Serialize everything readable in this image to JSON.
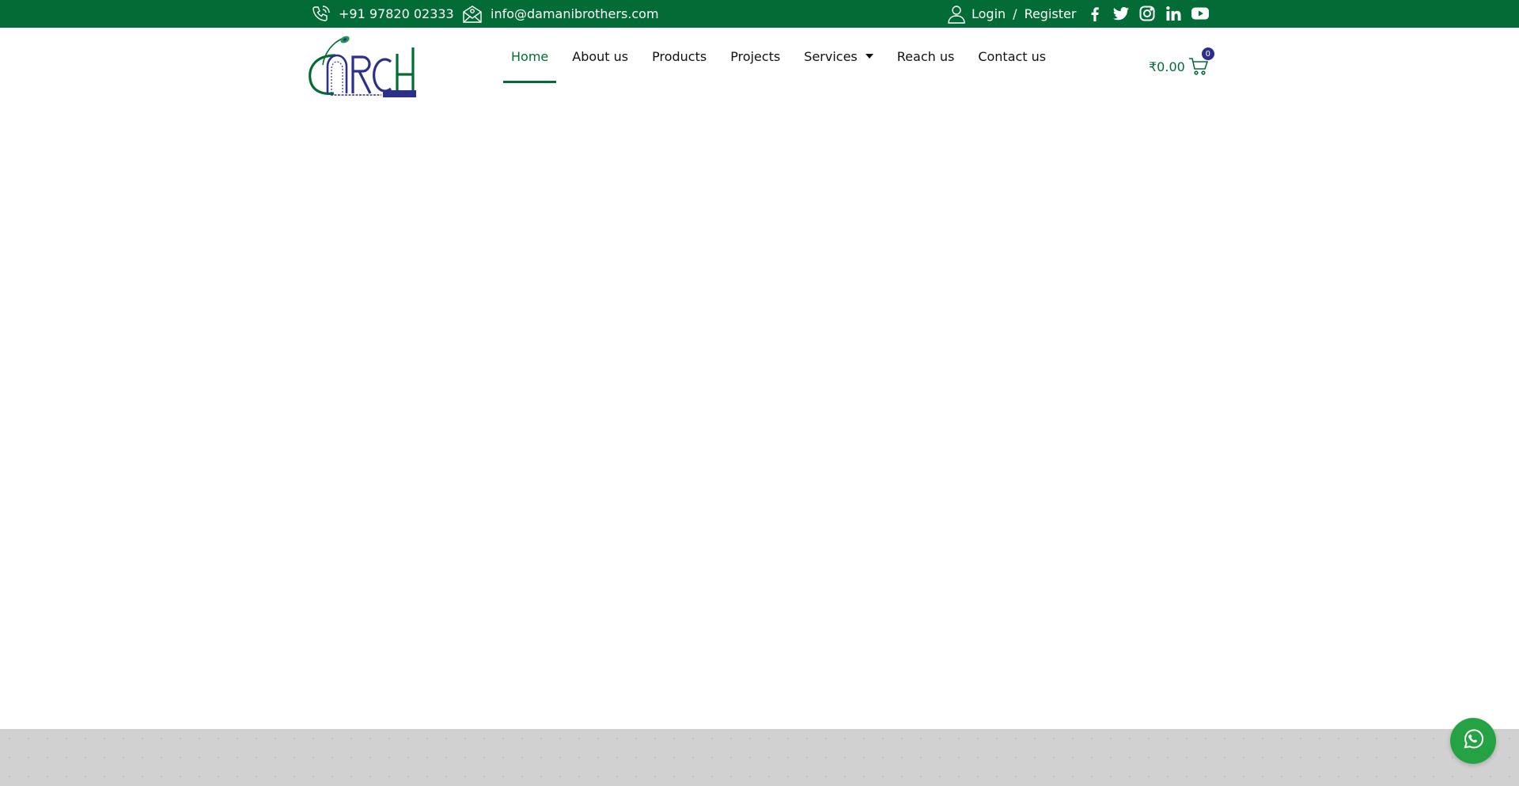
{
  "topbar": {
    "phone": "+91 97820 02333",
    "email": "info@damanibrothers.com",
    "login_label": "Login",
    "separator": "/",
    "register_label": "Register",
    "socials": [
      "facebook-icon",
      "twitter-icon",
      "instagram-icon",
      "linkedin-icon",
      "youtube-icon"
    ],
    "background_color": "#036b35"
  },
  "nav": {
    "items": [
      {
        "label": "Home",
        "active": true
      },
      {
        "label": "About us"
      },
      {
        "label": "Products"
      },
      {
        "label": "Projects"
      },
      {
        "label": "Services",
        "has_dropdown": true
      },
      {
        "label": "Reach us"
      },
      {
        "label": "Contact us"
      }
    ]
  },
  "cart": {
    "total": "₹0.00",
    "count": "0",
    "badge_color": "#2d2f8c"
  },
  "colors": {
    "accent": "#036b35",
    "footer_band": "#d1d1d1",
    "whatsapp": "#25a244"
  }
}
